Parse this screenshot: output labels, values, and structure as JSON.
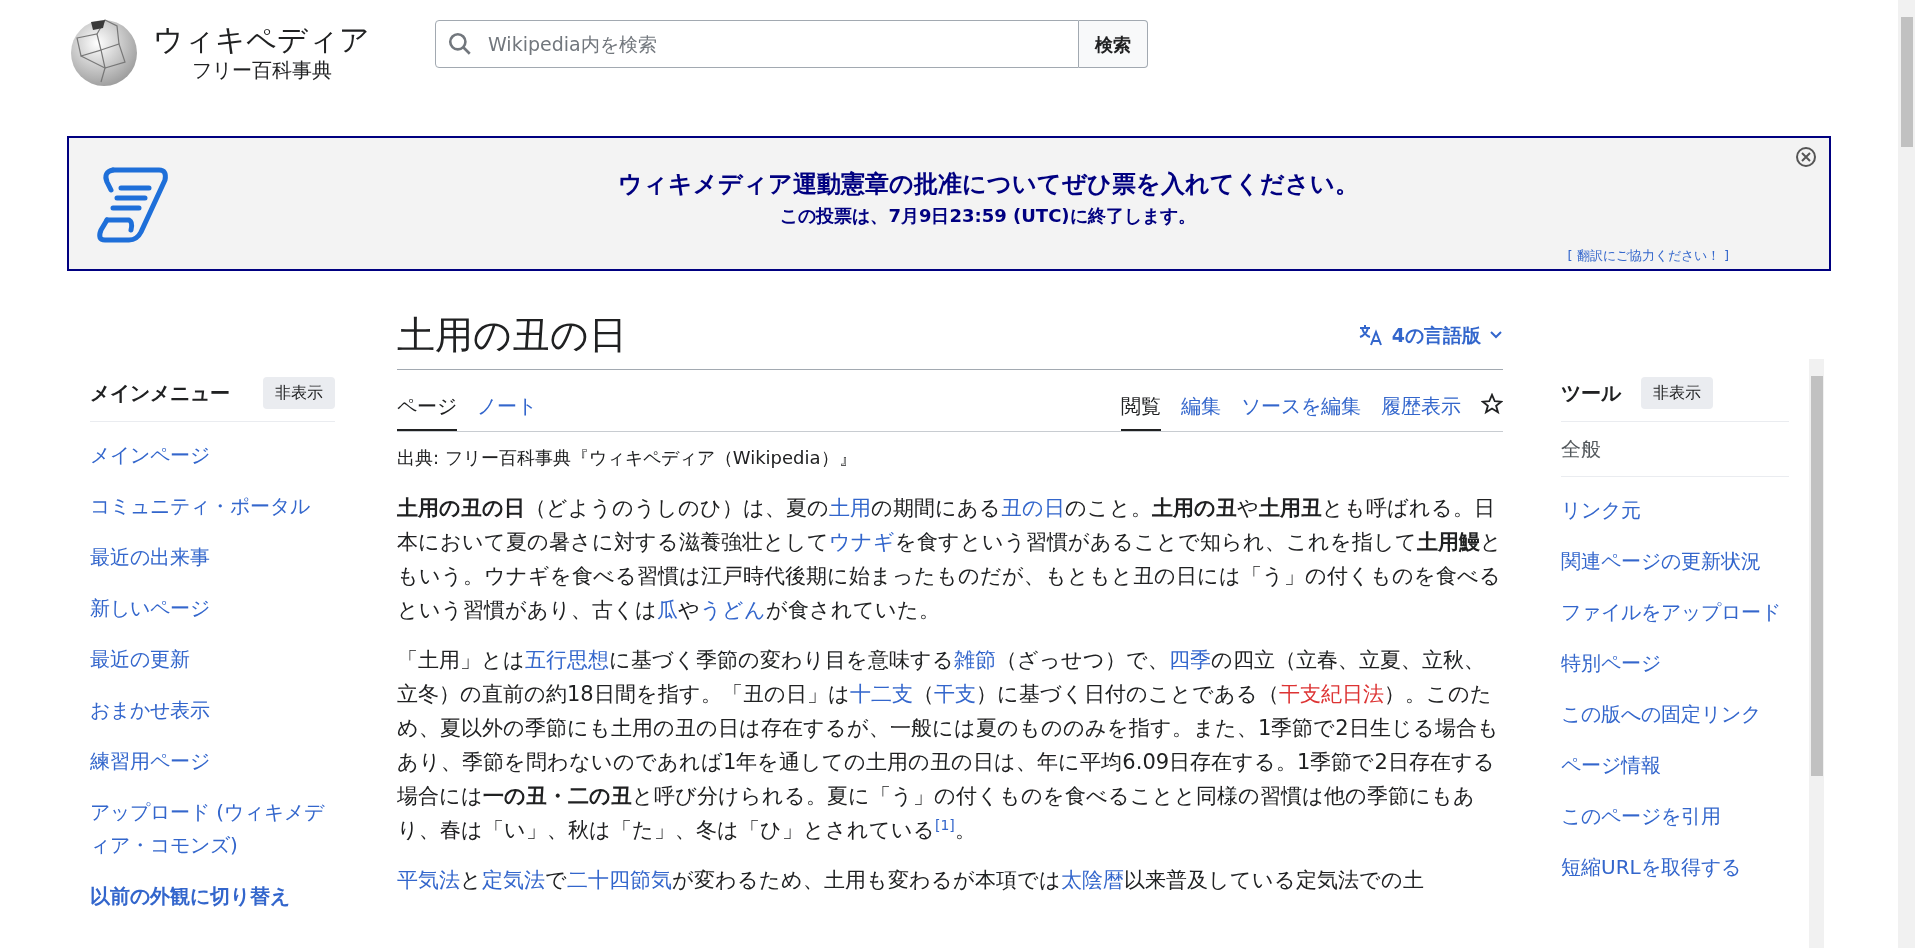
{
  "header": {
    "site_name": "ウィキペディア",
    "tagline": "フリー百科事典",
    "search": {
      "placeholder": "Wikipedia内を検索"
    },
    "search_button": "検索"
  },
  "banner": {
    "title": "ウィキメディア運動憲章の批准についてぜひ票を入れてください。",
    "subtitle": "この投票は、7月9日23:59 (UTC)に終了します。",
    "translate_link": "[ 翻訳にご協力ください！ ]"
  },
  "main_menu": {
    "heading": "メインメニュー",
    "hide_button": "非表示",
    "items": [
      {
        "label": "メインページ",
        "bold": false
      },
      {
        "label": "コミュニティ・ポータル",
        "bold": false
      },
      {
        "label": "最近の出来事",
        "bold": false
      },
      {
        "label": "新しいページ",
        "bold": false
      },
      {
        "label": "最近の更新",
        "bold": false
      },
      {
        "label": "おまかせ表示",
        "bold": false
      },
      {
        "label": "練習用ページ",
        "bold": false
      },
      {
        "label": "アップロード (ウィキメディア・コモンズ)",
        "bold": false
      },
      {
        "label": "以前の外観に切り替え",
        "bold": true
      }
    ]
  },
  "article": {
    "title": "土用の丑の日",
    "languages_button": "4の言語版",
    "namespace_tabs": [
      {
        "label": "ページ",
        "selected": true
      },
      {
        "label": "ノート",
        "selected": false
      }
    ],
    "view_tabs": [
      {
        "label": "閲覧",
        "selected": true
      },
      {
        "label": "編集",
        "selected": false
      },
      {
        "label": "ソースを編集",
        "selected": false
      },
      {
        "label": "履歴表示",
        "selected": false
      }
    ],
    "source": "出典: フリー百科事典『ウィキペディア（Wikipedia）』",
    "paragraphs": [
      [
        {
          "kind": "bold",
          "text": "土用の丑の日"
        },
        {
          "kind": "plain",
          "text": "（どようのうしのひ）は、夏の"
        },
        {
          "kind": "link",
          "text": "土用"
        },
        {
          "kind": "plain",
          "text": "の期間にある"
        },
        {
          "kind": "link",
          "text": "丑の日"
        },
        {
          "kind": "plain",
          "text": "のこと。"
        },
        {
          "kind": "bold",
          "text": "土用の丑"
        },
        {
          "kind": "plain",
          "text": "や"
        },
        {
          "kind": "bold",
          "text": "土用丑"
        },
        {
          "kind": "plain",
          "text": "とも呼ばれる。日本において夏の暑さに対する滋養強壮として"
        },
        {
          "kind": "link",
          "text": "ウナギ"
        },
        {
          "kind": "plain",
          "text": "を食すという習慣があることで知られ、これを指して"
        },
        {
          "kind": "bold",
          "text": "土用鰻"
        },
        {
          "kind": "plain",
          "text": "ともいう。ウナギを食べる習慣は江戸時代後期に始まったものだが、もともと丑の日には「う」の付くものを食べるという習慣があり、古くは"
        },
        {
          "kind": "link",
          "text": "瓜"
        },
        {
          "kind": "plain",
          "text": "や"
        },
        {
          "kind": "link",
          "text": "うどん"
        },
        {
          "kind": "plain",
          "text": "が食されていた。"
        }
      ],
      [
        {
          "kind": "plain",
          "text": "「土用」とは"
        },
        {
          "kind": "link",
          "text": "五行思想"
        },
        {
          "kind": "plain",
          "text": "に基づく季節の変わり目を意味する"
        },
        {
          "kind": "link",
          "text": "雑節"
        },
        {
          "kind": "plain",
          "text": "（ざっせつ）で、"
        },
        {
          "kind": "link",
          "text": "四季"
        },
        {
          "kind": "plain",
          "text": "の四立（立春、立夏、立秋、立冬）の直前の約18日間を指す。「丑の日」は"
        },
        {
          "kind": "link",
          "text": "十二支"
        },
        {
          "kind": "plain",
          "text": "（"
        },
        {
          "kind": "link",
          "text": "干支"
        },
        {
          "kind": "plain",
          "text": "）に基づく日付のことである（"
        },
        {
          "kind": "redlink",
          "text": "干支紀日法"
        },
        {
          "kind": "plain",
          "text": "）。このため、夏以外の季節にも土用の丑の日は存在するが、一般には夏のもののみを指す。また、1季節で2日生じる場合もあり、季節を問わないのであれば1年を通しての土用の丑の日は、年に平均6.09日存在する。1季節で2日存在する場合には"
        },
        {
          "kind": "bold",
          "text": "一の丑・二の丑"
        },
        {
          "kind": "plain",
          "text": "と呼び分けられる。夏に「う」の付くものを食べることと同様の習慣は他の季節にもあり、春は「い」、秋は「た」、冬は「ひ」とされている"
        },
        {
          "kind": "ref",
          "text": "[1]"
        },
        {
          "kind": "plain",
          "text": "。"
        }
      ],
      [
        {
          "kind": "link",
          "text": "平気法"
        },
        {
          "kind": "plain",
          "text": "と"
        },
        {
          "kind": "link",
          "text": "定気法"
        },
        {
          "kind": "plain",
          "text": "で"
        },
        {
          "kind": "link",
          "text": "二十四節気"
        },
        {
          "kind": "plain",
          "text": "が変わるため、土用も変わるが本項では"
        },
        {
          "kind": "link",
          "text": "太陰暦"
        },
        {
          "kind": "plain",
          "text": "以来普及している定気法での土"
        }
      ]
    ]
  },
  "tools": {
    "heading": "ツール",
    "hide_button": "非表示",
    "section": "全般",
    "items": [
      "リンク元",
      "関連ページの更新状況",
      "ファイルをアップロード",
      "特別ページ",
      "この版への固定リンク",
      "ページ情報",
      "このページを引用",
      "短縮URLを取得する"
    ]
  }
}
